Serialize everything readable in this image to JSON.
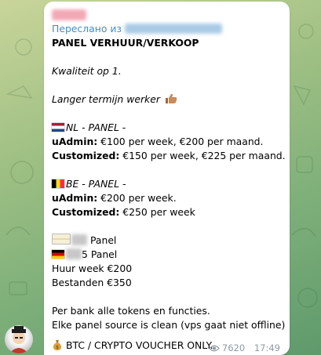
{
  "forwarded_label": "Переслано из",
  "message": {
    "title": "PANEL VERHUUR/VERKOOP",
    "quality": "Kwaliteit op 1.",
    "long_term": "Langer termijn werker",
    "nl": {
      "header": "NL - PANEL -",
      "uadmin_label": "uAdmin:",
      "uadmin_text": " €100 per week, €200 per maand.",
      "custom_label": "Customized:",
      "custom_text": " €150 per week, €225 per maand."
    },
    "be": {
      "header": "BE - PANEL -",
      "uadmin_label": "uAdmin:",
      "uadmin_text": " €200 per week.",
      "custom_label": "Customized:",
      "custom_text": " €250 per week"
    },
    "other": {
      "line1": "Panel",
      "line2_suffix": "5 Panel",
      "rent": "Huur week €200",
      "files": "Bestanden €350"
    },
    "bank_line": "Per bank alle tokens en functies.",
    "source_line": "Elke panel source is clean (vps gaat niet offline)",
    "footer": "BTC / CRYPTO VOUCHER ONLY."
  },
  "meta": {
    "views": "7620",
    "time": "17:49"
  },
  "icons": {
    "thumb": "thumbs-up-icon",
    "money": "money-bag-icon",
    "eye": "eye-icon",
    "nl_flag": "netherlands-flag-icon",
    "be_flag": "belgium-flag-icon",
    "de_flag": "germany-flag-icon"
  },
  "colors": {
    "link": "#3a8fce",
    "meta": "#8f9aa3",
    "background": "#9fc084"
  }
}
